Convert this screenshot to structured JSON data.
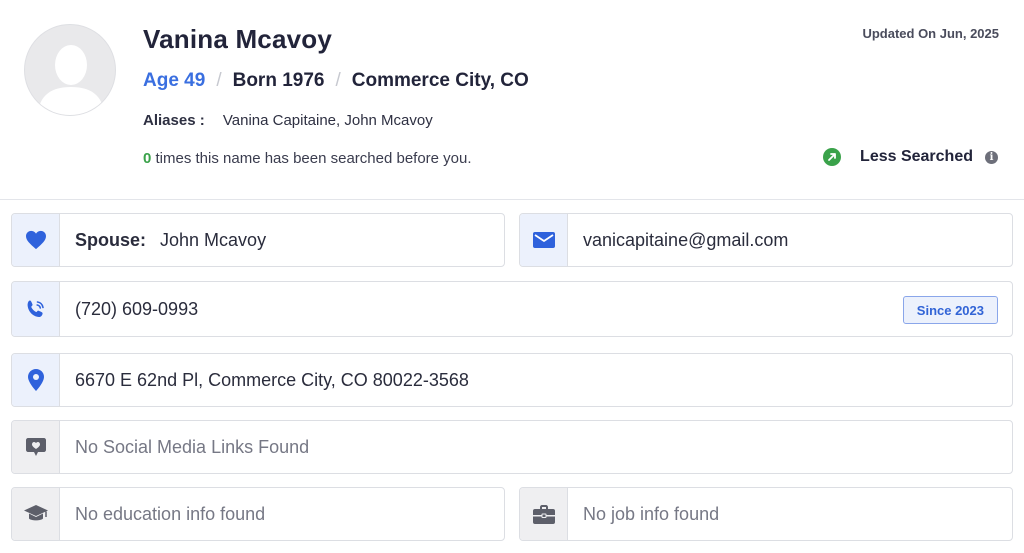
{
  "profile": {
    "name": "Vanina Mcavoy",
    "age": "Age 49",
    "born": "Born 1976",
    "location": "Commerce City, CO",
    "aliases_label": "Aliases :",
    "aliases_value": "Vanina Capitaine, John Mcavoy",
    "search_count": "0",
    "search_text": " times this name has been searched before you.",
    "updated": "Updated On Jun, 2025",
    "search_status": "Less Searched"
  },
  "details": {
    "spouse_label": "Spouse:",
    "spouse_value": "John Mcavoy",
    "email": "vanicapitaine@gmail.com",
    "phone": "(720) 609-0993",
    "phone_since": "Since 2023",
    "address": "6670 E 62nd Pl, Commerce City, CO 80022-3568",
    "social": "No Social Media Links Found",
    "education": "No education info found",
    "job": "No job info found"
  },
  "colors": {
    "accent_blue": "#3a6fe0",
    "status_green": "#3aa24a",
    "icon_blue": "#2f62dc",
    "icon_gray": "#5d5f6a"
  },
  "icons": [
    "user-silhouette-icon",
    "trend-up-icon",
    "info-icon",
    "heart-icon",
    "mail-icon",
    "phone-icon",
    "location-pin-icon",
    "social-chat-icon",
    "graduation-cap-icon",
    "briefcase-icon"
  ]
}
